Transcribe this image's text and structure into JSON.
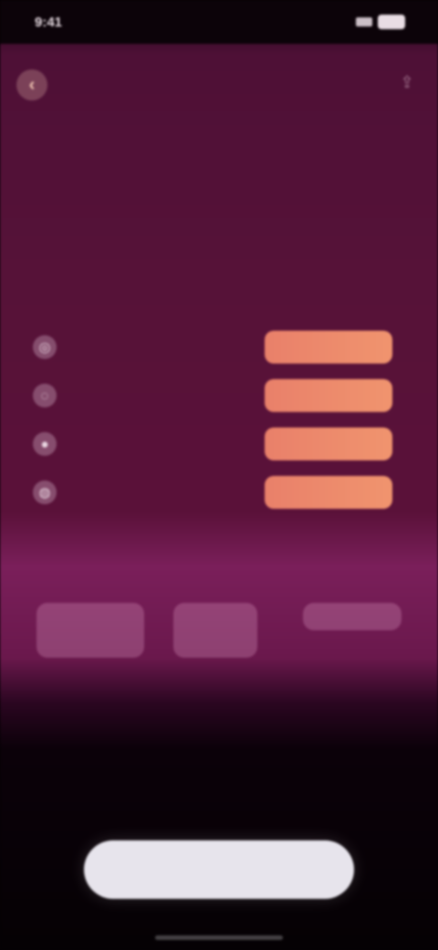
{
  "status_bar": {
    "time": "9:41"
  },
  "header": {
    "back_label": "‹",
    "share_label": "⇪"
  },
  "eyebrow": "",
  "headline": "",
  "features": [
    {
      "icon": "globe-icon",
      "glyph": "◎",
      "label": "",
      "value": ""
    },
    {
      "icon": "chat-icon",
      "glyph": "◌",
      "label": "",
      "value": ""
    },
    {
      "icon": "user-icon",
      "glyph": "●",
      "label": "",
      "value": ""
    },
    {
      "icon": "lock-icon",
      "glyph": "◍",
      "label": "",
      "value": ""
    }
  ],
  "plans": [
    {
      "name": "",
      "price": ""
    },
    {
      "name": "",
      "price": ""
    },
    {
      "name": "",
      "price": ""
    }
  ],
  "footnote": "",
  "cta": {
    "label": ""
  },
  "colors": {
    "accent": "#ee8a6c",
    "background": "#561238",
    "cta": "#e7e4ec"
  }
}
